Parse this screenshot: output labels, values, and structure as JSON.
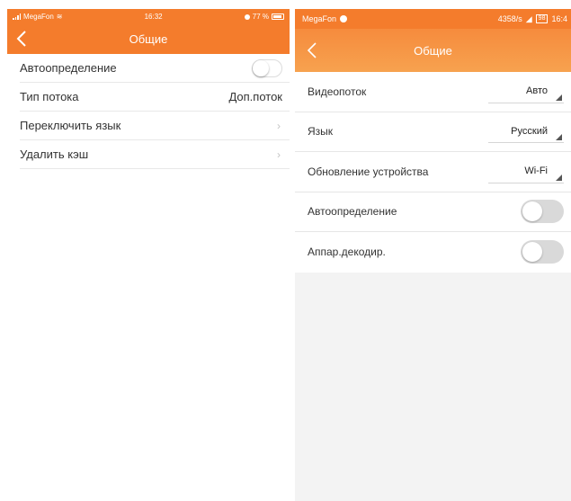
{
  "left": {
    "statusbar": {
      "carrier": "MegaFon",
      "time": "16:32",
      "battery": "77 %"
    },
    "navbar": {
      "title": "Общие"
    },
    "rows": [
      {
        "label": "Автоопределение"
      },
      {
        "label": "Тип потока",
        "value": "Доп.поток"
      },
      {
        "label": "Переключить язык",
        "chevron": "›"
      },
      {
        "label": "Удалить кэш",
        "chevron": "›"
      }
    ]
  },
  "right": {
    "statusbar": {
      "carrier": "MegaFon",
      "speed": "4358/s",
      "battery": "98",
      "time": "16:4"
    },
    "navbar": {
      "title": "Общие"
    },
    "rows": [
      {
        "label": "Видеопоток",
        "value": "Авто"
      },
      {
        "label": "Язык",
        "value": "Русский"
      },
      {
        "label": "Обновление устройства",
        "value": "Wi-Fi"
      },
      {
        "label": "Автоопределение"
      },
      {
        "label": "Аппар.декодир."
      }
    ]
  },
  "colors": {
    "accent": "#f47c2c",
    "accent_light": "#f7a24f"
  }
}
